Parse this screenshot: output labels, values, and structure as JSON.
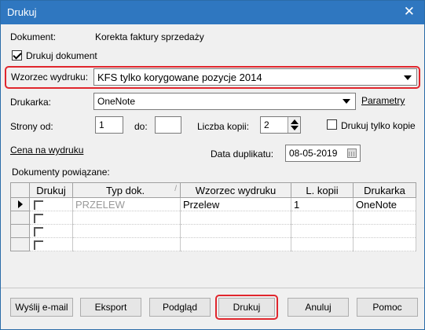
{
  "window": {
    "title": "Drukuj",
    "close": "✕"
  },
  "form": {
    "dokument_label": "Dokument:",
    "dokument_value": "Korekta faktury sprzedaży",
    "drukuj_dokument_label": "Drukuj dokument",
    "drukuj_dokument_checked": true,
    "wzorzec_label": "Wzorzec wydruku:",
    "wzorzec_value": "KFS tylko korygowane pozycje 2014",
    "drukarka_label": "Drukarka:",
    "drukarka_value": "OneNote",
    "parametry_link": "Parametry",
    "strony_od_label": "Strony od:",
    "strony_od_value": "1",
    "do_label": "do:",
    "do_value": "",
    "liczba_kopii_label": "Liczba kopii:",
    "liczba_kopii_value": "2",
    "drukuj_tylko_kopie_label": "Drukuj tylko kopie",
    "drukuj_tylko_kopie_checked": false,
    "cena_link": "Cena na wydruku",
    "data_duplikatu_label": "Data duplikatu:",
    "data_duplikatu_value": "08-05-2019",
    "dokumenty_label": "Dokumenty powiązane:"
  },
  "grid": {
    "columns": [
      "Drukuj",
      "Typ dok.",
      "Wzorzec wydruku",
      "L. kopii",
      "Drukarka"
    ],
    "rows": [
      {
        "typ": "PRZELEW",
        "wzorzec": "Przelew",
        "kopii": "1",
        "drukarka": "OneNote"
      },
      {
        "typ": "",
        "wzorzec": "",
        "kopii": "",
        "drukarka": ""
      },
      {
        "typ": "",
        "wzorzec": "",
        "kopii": "",
        "drukarka": ""
      },
      {
        "typ": "",
        "wzorzec": "",
        "kopii": "",
        "drukarka": ""
      }
    ]
  },
  "buttons": {
    "email": "Wyślij e-mail",
    "eksport": "Eksport",
    "podglad": "Podgląd",
    "drukuj": "Drukuj",
    "anuluj": "Anuluj",
    "pomoc": "Pomoc"
  },
  "colors": {
    "titlebar": "#2f77c0",
    "highlight": "#e0262d"
  }
}
